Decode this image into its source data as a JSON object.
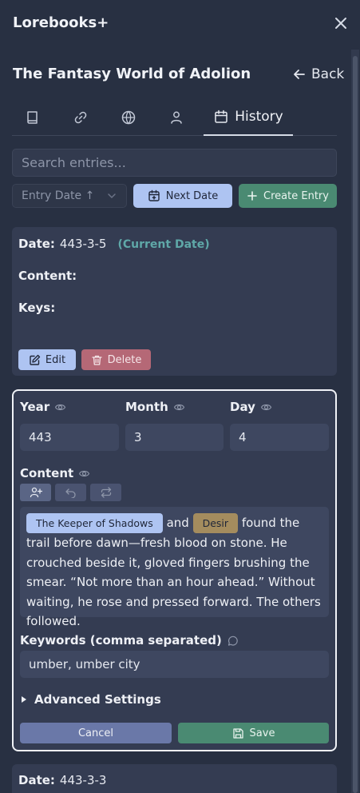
{
  "app": {
    "title": "Lorebooks+"
  },
  "book": {
    "title": "The Fantasy World of Adolion",
    "back_label": "Back"
  },
  "tabs": [
    {
      "icon": "book-icon"
    },
    {
      "icon": "link-icon"
    },
    {
      "icon": "globe-icon"
    },
    {
      "icon": "user-icon"
    },
    {
      "icon": "calendar-icon",
      "label": "History",
      "active": true
    }
  ],
  "search": {
    "placeholder": "Search entries..."
  },
  "toolbar": {
    "sort_label": "Entry Date ↑",
    "next_date_label": "Next Date",
    "create_entry_label": "Create Entry"
  },
  "entry": {
    "date_label": "Date:",
    "date_value": "443-3-5",
    "current_badge": "(Current Date)",
    "content_label": "Content:",
    "keys_label": "Keys:",
    "edit_label": "Edit",
    "delete_label": "Delete"
  },
  "editor": {
    "year_label": "Year",
    "year_value": "443",
    "month_label": "Month",
    "month_value": "3",
    "day_label": "Day",
    "day_value": "4",
    "content_label": "Content",
    "content": {
      "chip1": "The Keeper of Shadows",
      "text1": "and",
      "chip2": "Desir",
      "text2": "found the trail before dawn—fresh blood on stone. He crouched beside it, gloved fingers brushing the smear. “Not more than an hour ahead.” Without waiting, he rose and pressed forward. The others followed."
    },
    "keywords_label": "Keywords (comma separated)",
    "keywords_value": "umber, umber city",
    "advanced_label": "Advanced Settings",
    "cancel_label": "Cancel",
    "save_label": "Save"
  },
  "next_entry": {
    "date_label": "Date:",
    "date_value": "443-3-3"
  },
  "colors": {
    "background": "#283042",
    "card": "#343c52",
    "primary": "#aec4f2",
    "success": "#4a8a72",
    "danger": "#b56876",
    "accent_teal": "#5fa8a8",
    "chip_gold": "#a48c5e"
  }
}
